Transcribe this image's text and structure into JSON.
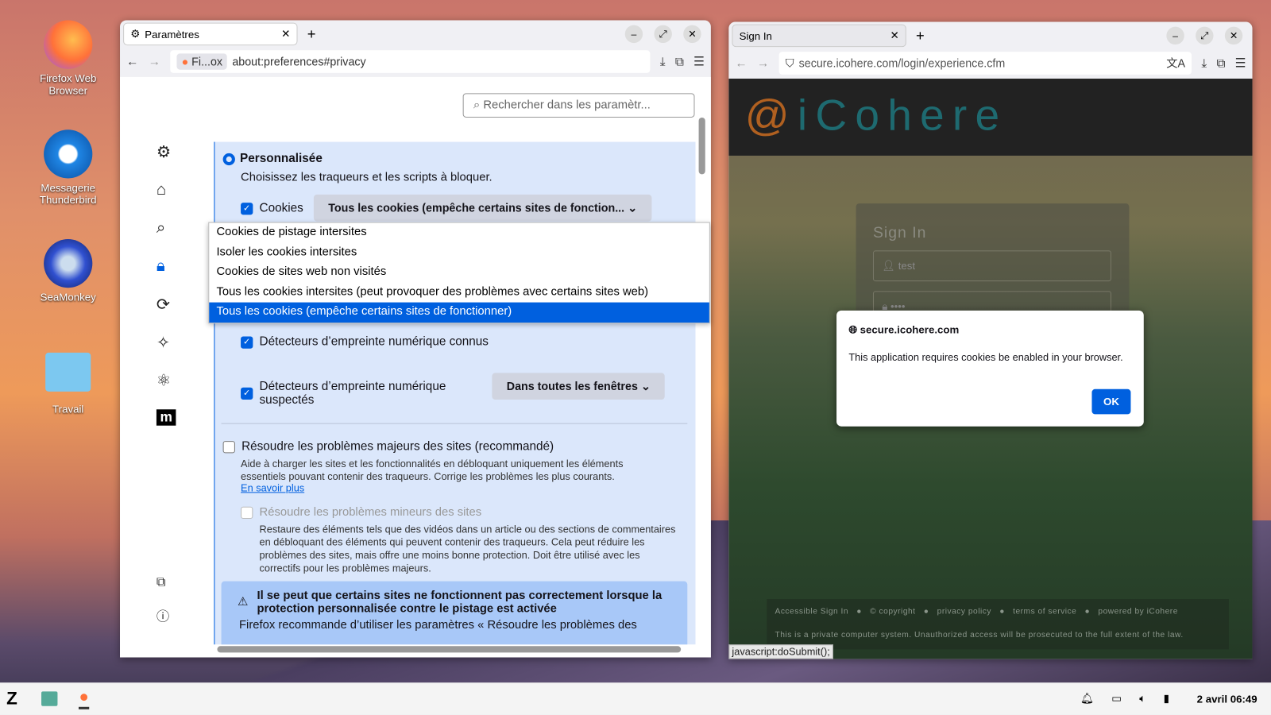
{
  "desktop": {
    "icons": [
      {
        "label": "Firefox Web Browser"
      },
      {
        "label": "Messagerie Thunderbird"
      },
      {
        "label": "SeaMonkey"
      },
      {
        "label": "Travail"
      }
    ]
  },
  "left_window": {
    "tab_title": "Paramètres",
    "url_identity": "Fi...ox",
    "url": "about:preferences#privacy",
    "search_placeholder": "Rechercher dans les paramètr...",
    "custom_label": "Personnalisée",
    "custom_desc": "Choisissez les traqueurs et les scripts à bloquer.",
    "cookies_label": "Cookies",
    "cookies_select": "Tous les cookies (empêche certains sites de fonction...",
    "dropdown": [
      "Cookies de pistage intersites",
      "Isoler les cookies intersites",
      "Cookies de sites web non visités",
      "Tous les cookies intersites (peut provoquer des problèmes avec certains sites web)",
      "Tous les cookies (empêche certains sites de fonctionner)"
    ],
    "fingerprint_known": "Détecteurs d’empreinte numérique connus",
    "fingerprint_suspect": "Détecteurs d’empreinte numérique suspectés",
    "fingerprint_select": "Dans toutes les fenêtres",
    "major_label": "Résoudre les problèmes majeurs des sites (recommandé)",
    "major_desc": "Aide à charger les sites et les fonctionnalités en débloquant uniquement les éléments essentiels pouvant contenir des traqueurs. Corrige les problèmes les plus courants.",
    "learn_more": "En savoir plus",
    "minor_label": "Résoudre les problèmes mineurs des sites",
    "minor_desc": "Restaure des éléments tels que des vidéos dans un article ou des sections de commentaires en débloquant des éléments qui peuvent contenir des traqueurs. Cela peut réduire les problèmes des sites, mais offre une moins bonne protection. Doit être utilisé avec les correctifs pour les problèmes majeurs.",
    "warning_title": "Il se peut que certains sites ne fonctionnent pas correctement lorsque la protection personnalisée contre le pistage est activée",
    "warning_text": "Firefox recommande d’utiliser les paramètres « Résoudre les problèmes des"
  },
  "right_window": {
    "tab_title": "Sign In",
    "url": "secure.icohere.com/login/experience.cfm",
    "logo": "iCohere",
    "signin_title": "Sign In",
    "username": "test",
    "password": "••••",
    "dialog": {
      "origin": "secure.icohere.com",
      "message": "This application requires cookies be enabled in your browser.",
      "ok": "OK"
    },
    "footer_links": [
      "Accessible Sign In",
      "© copyright",
      "privacy policy",
      "terms of service",
      "powered by iCohere"
    ],
    "footer_notice": "This is a private computer system. Unauthorized access will be prosecuted to the full extent of the law.",
    "status": "javascript:doSubmit();"
  },
  "taskbar": {
    "clock": "2 avril 06:49"
  }
}
